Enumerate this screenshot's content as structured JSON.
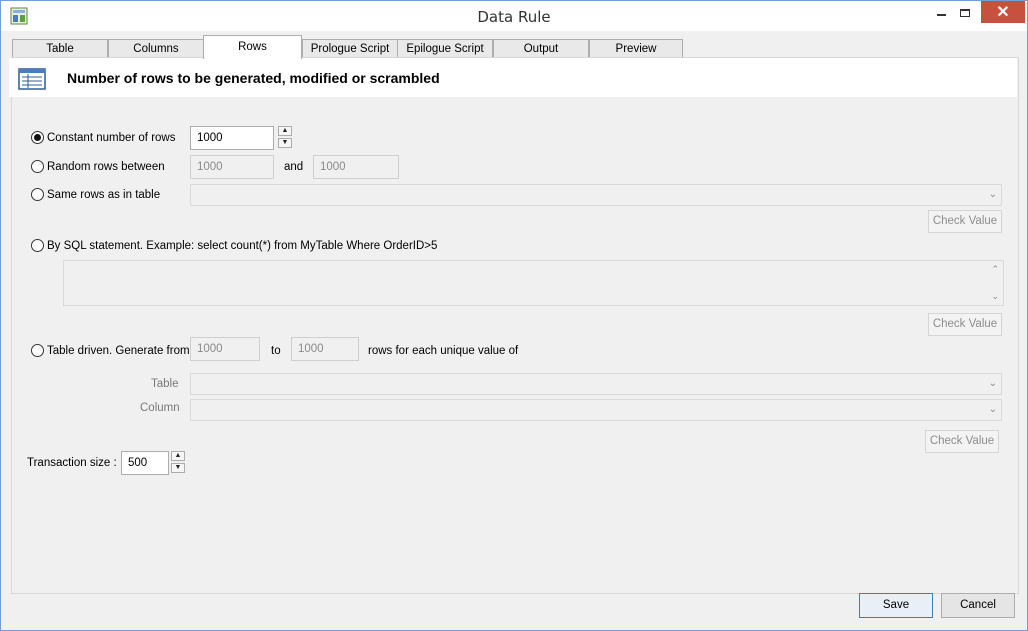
{
  "window": {
    "title": "Data Rule",
    "close_glyph": "✕"
  },
  "tabs": [
    {
      "label": "Table"
    },
    {
      "label": "Columns"
    },
    {
      "label": "Rows"
    },
    {
      "label": "Prologue Script"
    },
    {
      "label": "Epilogue Script"
    },
    {
      "label": "Output"
    },
    {
      "label": "Preview"
    }
  ],
  "active_tab": "Rows",
  "header": {
    "title": "Number of rows to be generated, modified or scrambled",
    "icon": "table-rows-icon"
  },
  "options": {
    "constant": {
      "label": "Constant number of rows",
      "value": "1000",
      "checked": true
    },
    "random": {
      "label": "Random rows between",
      "from": "1000",
      "and_label": "and",
      "to": "1000"
    },
    "same": {
      "label": "Same rows as in table",
      "check_value": "Check Value"
    },
    "sql": {
      "label": "By SQL statement.  Example: select count(*) from MyTable Where OrderID>5",
      "check_value": "Check Value"
    },
    "table_driven": {
      "label": "Table driven. Generate from",
      "from": "1000",
      "to_label": "to",
      "to": "1000",
      "suffix": "rows for each unique value of",
      "table_label": "Table",
      "column_label": "Column",
      "check_value": "Check Value"
    }
  },
  "transaction": {
    "label": "Transaction size :",
    "value": "500"
  },
  "buttons": {
    "save": "Save",
    "cancel": "Cancel"
  },
  "colors": {
    "accent": "#3c7fb1",
    "close": "#c7503e"
  }
}
